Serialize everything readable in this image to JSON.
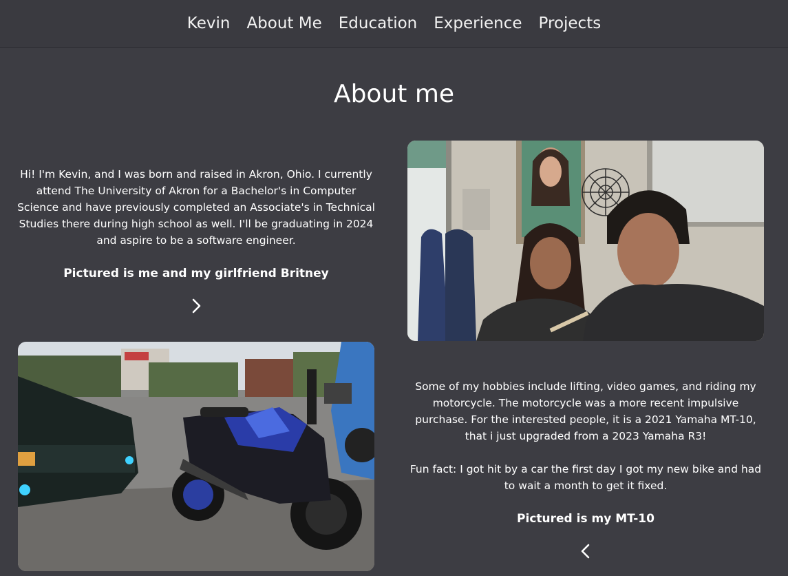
{
  "nav": {
    "items": [
      "Kevin",
      "About Me",
      "Education",
      "Experience",
      "Projects"
    ]
  },
  "about": {
    "title": "About me",
    "intro": "Hi! I'm Kevin, and I was born and raised in Akron, Ohio. I currently attend The University of Akron for a Bachelor's in Computer Science and have previously completed an Associate's in Technical Studies there during high school as well. I'll be graduating in 2024 and aspire to be a software engineer.",
    "caption1": "Pictured is me and my girlfriend Britney",
    "hobbies": "Some of my hobbies include lifting, video games, and riding my motorcycle. The motorcycle was a more recent impulsive purchase. For the interested people, it is a 2021 Yamaha MT-10, that i just upgraded from a 2023 Yamaha R3!",
    "funfact": "Fun fact: I got hit by a car the first day I got my new bike and had to wait a month to get it fixed.",
    "caption2": "Pictured is my MT-10"
  },
  "icons": {
    "next": "chevron-right-icon",
    "prev": "chevron-left-icon"
  },
  "colors": {
    "background": "#3d3d43",
    "nav_background": "#3a3a40",
    "text": "#ffffff"
  }
}
